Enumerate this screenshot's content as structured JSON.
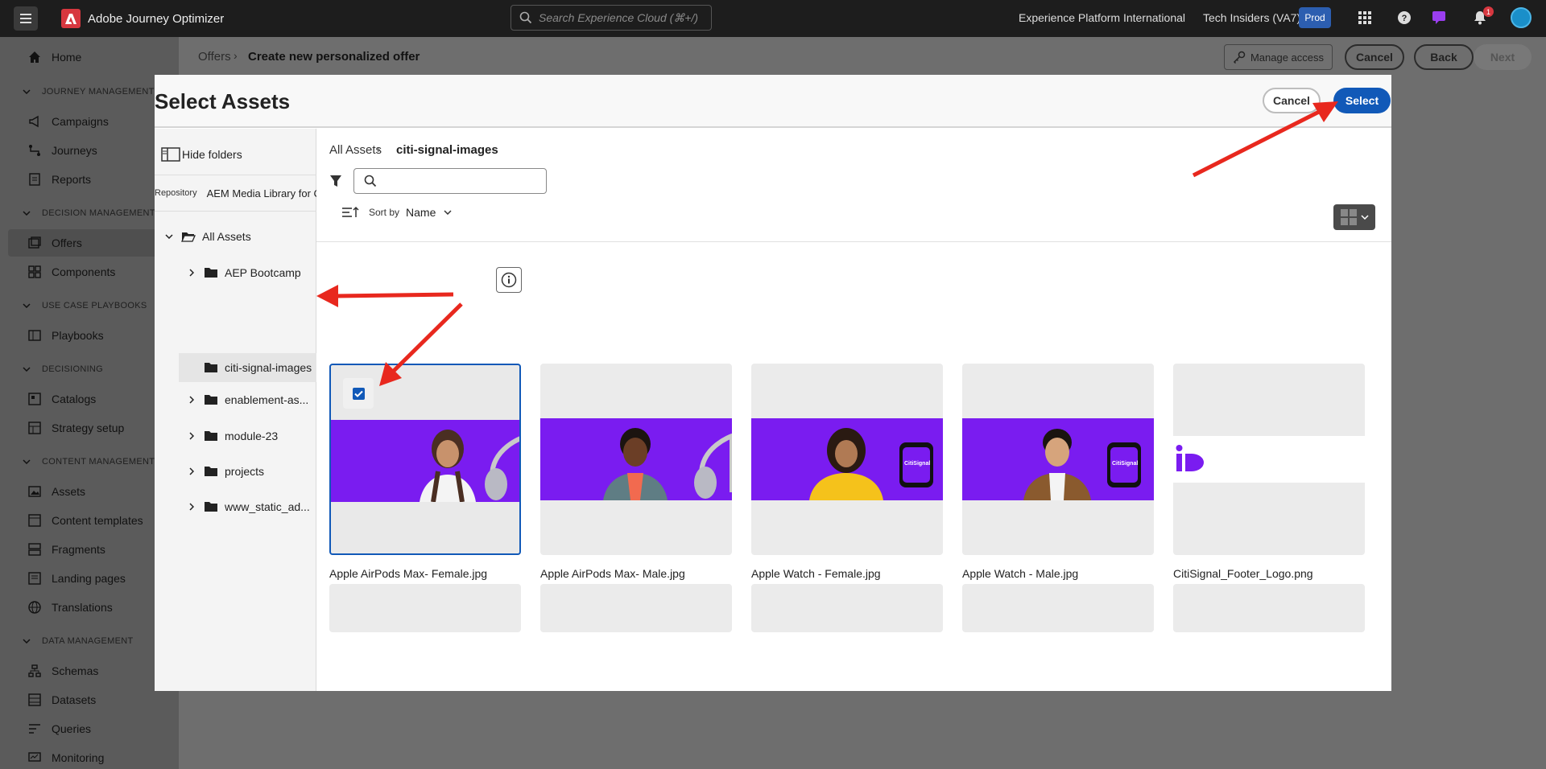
{
  "topbar": {
    "app_title": "Adobe Journey Optimizer",
    "search_placeholder": "Search Experience Cloud (⌘+/)",
    "org": "Experience Platform International",
    "sandbox": "Tech Insiders (VA7)",
    "env_badge": "Prod",
    "notification_count": "1"
  },
  "sidebar": {
    "home": "Home",
    "sections": {
      "journey": "JOURNEY MANAGEMENT",
      "decision": "DECISION MANAGEMENT",
      "playbooks": "USE CASE PLAYBOOKS",
      "decisioning": "DECISIONING",
      "content": "CONTENT MANAGEMENT",
      "data": "DATA MANAGEMENT"
    },
    "items": {
      "campaigns": "Campaigns",
      "journeys": "Journeys",
      "reports": "Reports",
      "offers": "Offers",
      "components": "Components",
      "playbooks": "Playbooks",
      "catalogs": "Catalogs",
      "strategy": "Strategy setup",
      "assets": "Assets",
      "content_templates": "Content templates",
      "fragments": "Fragments",
      "landing_pages": "Landing pages",
      "translations": "Translations",
      "schemas": "Schemas",
      "datasets": "Datasets",
      "queries": "Queries",
      "monitoring": "Monitoring"
    }
  },
  "page": {
    "breadcrumb_parent": "Offers",
    "breadcrumb_current": "Create new personalized offer",
    "manage_access": "Manage access",
    "cancel": "Cancel",
    "back": "Back",
    "next": "Next"
  },
  "modal": {
    "title": "Select Assets",
    "cancel": "Cancel",
    "select": "Select",
    "hide_folders": "Hide folders",
    "repository_label": "Repository",
    "repository_value": "AEM Media Library for C",
    "tree": {
      "root": "All Assets",
      "folders": [
        "AEP Bootcamp",
        "citi-signal-images",
        "enablement-as...",
        "module-23",
        "projects",
        "www_static_ad..."
      ]
    },
    "breadcrumb_root": "All Assets",
    "breadcrumb_current": "citi-signal-images",
    "search_value": "",
    "sort_by_label": "Sort by",
    "sort_value": "Name",
    "assets": [
      {
        "name": "Apple AirPods Max- Female.jpg",
        "type": "IMAGE/JPEG",
        "selected": true
      },
      {
        "name": "Apple AirPods Max- Male.jpg",
        "type": "IMAGE/JPEG",
        "selected": false
      },
      {
        "name": "Apple Watch - Female.jpg",
        "type": "IMAGE/JPEG",
        "selected": false
      },
      {
        "name": "Apple Watch - Male.jpg",
        "type": "IMAGE/JPEG",
        "selected": false
      },
      {
        "name": "CitiSignal_Footer_Logo.png",
        "type": "IMAGE/PNG",
        "selected": false
      }
    ],
    "watch_brand_text": "CitiSignal"
  },
  "colors": {
    "accent": "#1159b8",
    "banner_purple": "#7a1cf0",
    "annotation_red": "#e8281e"
  }
}
